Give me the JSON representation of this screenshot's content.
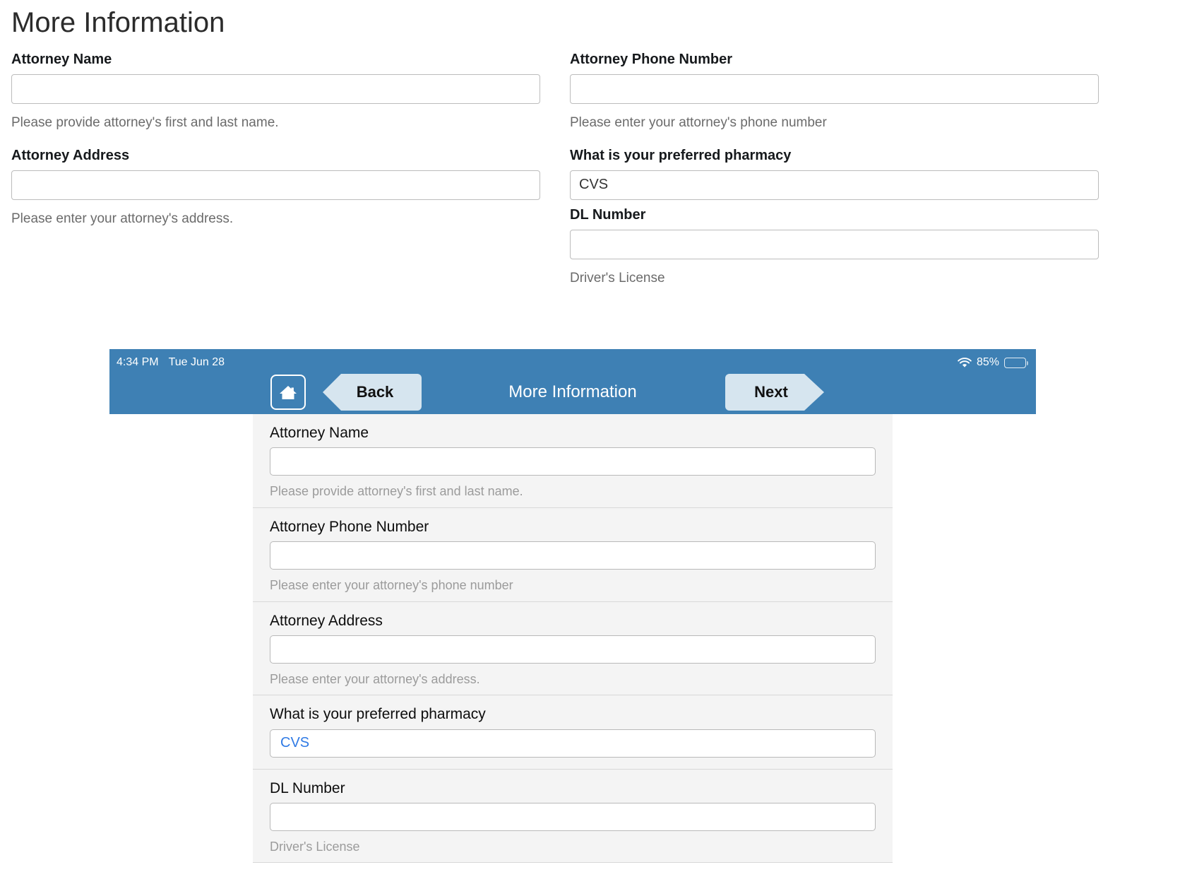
{
  "web": {
    "title": "More Information",
    "left_fields": [
      {
        "label": "Attorney Name",
        "value": "",
        "placeholder": "",
        "help": "Please provide attorney's first and last name."
      },
      {
        "label": "Attorney Address",
        "value": "",
        "placeholder": "",
        "help": "Please enter your attorney's address."
      }
    ],
    "right_fields": [
      {
        "label": "Attorney Phone Number",
        "value": "",
        "placeholder": "",
        "help": "Please enter your attorney's phone number"
      },
      {
        "label": "What is your preferred pharmacy",
        "value": "CVS",
        "placeholder": "",
        "help": ""
      },
      {
        "label": "DL Number",
        "value": "",
        "placeholder": "",
        "help": "Driver's License"
      }
    ]
  },
  "ipad": {
    "status": {
      "time": "4:34 PM",
      "date": "Tue Jun 28",
      "battery_percent": "85%",
      "wifi_icon": "wifi-icon",
      "battery_icon": "battery-icon"
    },
    "nav": {
      "home_icon": "home-icon",
      "back_label": "Back",
      "title": "More Information",
      "next_label": "Next"
    },
    "rows": [
      {
        "label": "Attorney Name",
        "value": "",
        "help": "Please provide attorney's first and last name.",
        "accent": false
      },
      {
        "label": "Attorney Phone Number",
        "value": "",
        "help": "Please enter your attorney's phone number",
        "accent": false
      },
      {
        "label": "Attorney Address",
        "value": "",
        "help": "Please enter your attorney's address.",
        "accent": false
      },
      {
        "label": "What is your preferred pharmacy",
        "value": "CVS",
        "help": "",
        "accent": true
      },
      {
        "label": "DL Number",
        "value": "",
        "help": "Driver's License",
        "accent": false
      }
    ]
  },
  "colors": {
    "toolbar_blue": "#3e80b4",
    "button_light_blue": "#d6e5ef",
    "accent_text_blue": "#2f7ae5",
    "help_gray": "#6b6b6b"
  }
}
